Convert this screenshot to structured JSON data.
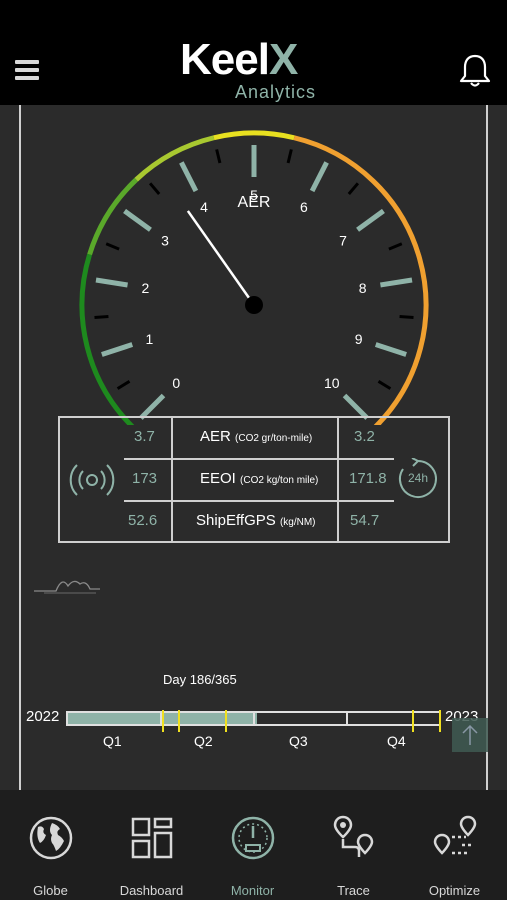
{
  "header": {
    "logo_main_1": "Keel",
    "logo_main_2": "X",
    "logo_sub": "Analytics",
    "menu_icon": "hamburger-menu-icon",
    "bell_icon": "bell-icon"
  },
  "gauge": {
    "title": "AER",
    "min": 0,
    "max": 10,
    "value": 3.7,
    "scale_labels": [
      "0",
      "1",
      "2",
      "3",
      "4",
      "5",
      "6",
      "7",
      "8",
      "9",
      "10"
    ],
    "zone_colors": [
      "#1e8a1e",
      "#5aa82a",
      "#a8c830",
      "#e8e020",
      "#f0a030"
    ]
  },
  "metrics": {
    "rows": [
      {
        "left": "3.7",
        "label": "AER",
        "unit": "(CO2 gr/ton-mile)",
        "right": "3.2"
      },
      {
        "left": "173",
        "label": "EEOI",
        "unit": "(CO2 kg/ton mile)",
        "right": "171.8"
      },
      {
        "left": "52.6",
        "label": "ShipEffGPS",
        "unit": "(kg/NM)",
        "right": "54.7"
      }
    ],
    "live_icon": "broadcast-signal-icon",
    "period_icon": "24h-refresh-icon",
    "period_label": "24h"
  },
  "timeline": {
    "day_label": "Day 186/365",
    "progress": 0.51,
    "start_year": "2022",
    "end_year": "2023",
    "quarters": [
      "Q1",
      "Q2",
      "Q3",
      "Q4"
    ],
    "marker_color": "#f0e020",
    "markers": [
      0.254,
      0.296,
      0.423,
      0.926
    ]
  },
  "nav": {
    "items": [
      {
        "label": "Globe",
        "icon": "globe-icon",
        "active": false
      },
      {
        "label": "Dashboard",
        "icon": "dashboard-grid-icon",
        "active": false
      },
      {
        "label": "Monitor",
        "icon": "speedometer-icon",
        "active": true
      },
      {
        "label": "Trace",
        "icon": "route-pins-icon",
        "active": false
      },
      {
        "label": "Optimize",
        "icon": "optimize-route-icon",
        "active": false
      }
    ]
  },
  "accent_color": "#8fb3a8"
}
